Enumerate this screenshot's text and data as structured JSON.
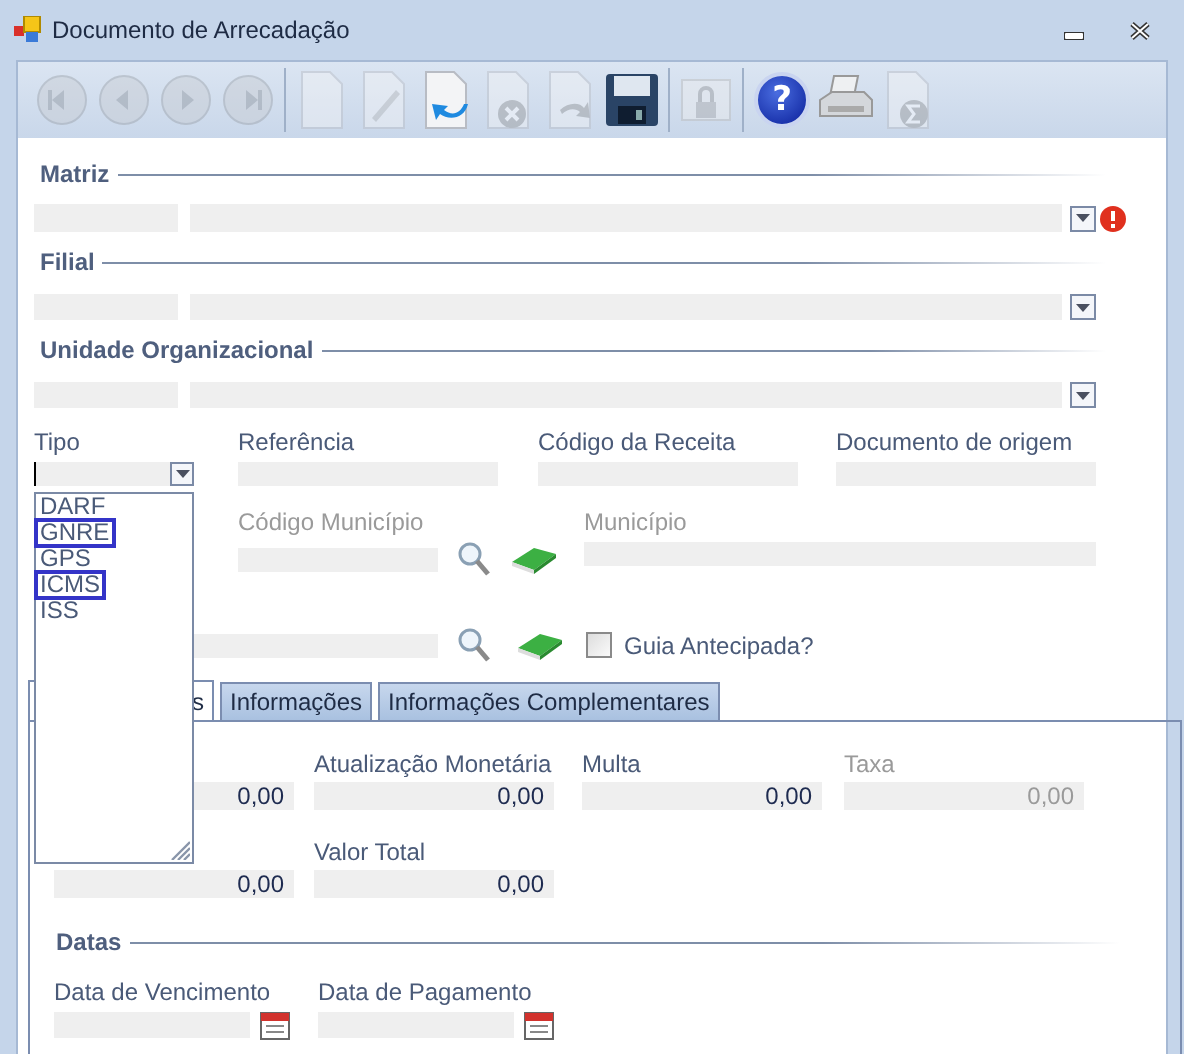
{
  "window": {
    "title": "Documento de Arrecadação"
  },
  "toolbar": [
    {
      "tools": [
        {
          "kind": "first",
          "disabled": true
        },
        {
          "kind": "previous",
          "disabled": true
        },
        {
          "kind": "next",
          "disabled": true
        },
        {
          "kind": "last",
          "disabled": true
        }
      ]
    },
    {
      "tools": [
        {
          "kind": "new",
          "disabled": true
        },
        {
          "kind": "edit",
          "disabled": true
        },
        {
          "kind": "undo",
          "disabled": false
        },
        {
          "kind": "cancel",
          "disabled": true
        },
        {
          "kind": "redo",
          "disabled": true
        },
        {
          "kind": "save",
          "disabled": false
        }
      ]
    },
    {
      "tools": [
        {
          "kind": "lock",
          "disabled": true
        }
      ]
    },
    {
      "tools": [
        {
          "kind": "help",
          "disabled": false,
          "glyph": "?"
        },
        {
          "kind": "print",
          "disabled": false
        },
        {
          "kind": "sum",
          "disabled": true
        }
      ]
    }
  ],
  "sections": [
    {
      "title": "Matriz",
      "error": true
    },
    {
      "title": "Filial",
      "error": false
    },
    {
      "title": "Unidade Organizacional",
      "error": false
    }
  ],
  "tipo": {
    "label": "Tipo",
    "expanded": true,
    "options": [
      {
        "label": "DARF",
        "highlighted": false
      },
      {
        "label": "GNRE",
        "highlighted": true
      },
      {
        "label": "GPS",
        "highlighted": false
      },
      {
        "label": "ICMS",
        "highlighted": true
      },
      {
        "label": "ISS",
        "highlighted": false
      }
    ]
  },
  "fields": [
    {
      "label": "Referência"
    },
    {
      "label": "Código da Receita"
    },
    {
      "label": "Documento de origem"
    }
  ],
  "municipio": {
    "code_label": "Código Município",
    "name_label": "Município",
    "disabled": true
  },
  "guia_antecipada": {
    "label": "Guia Antecipada?",
    "checked": false
  },
  "tabs": [
    {
      "label": "s",
      "selected": true
    },
    {
      "label": "Informações",
      "selected": false
    },
    {
      "label": "Informações Complementares",
      "selected": false
    }
  ],
  "value_rows": [
    [
      {
        "value": "0,00",
        "disabled": false
      },
      {
        "label": "Atualização Monetária",
        "value": "0,00",
        "disabled": false
      },
      {
        "label": "Multa",
        "value": "0,00",
        "disabled": false
      },
      {
        "label": "Taxa",
        "value": "0,00",
        "disabled": true
      }
    ],
    [
      {
        "value": "0,00",
        "disabled": false
      },
      {
        "label": "Valor Total",
        "value": "0,00",
        "disabled": false
      }
    ]
  ],
  "datas": {
    "title": "Datas",
    "fields": [
      {
        "label": "Data de Vencimento"
      },
      {
        "label": "Data de Pagamento"
      }
    ]
  }
}
